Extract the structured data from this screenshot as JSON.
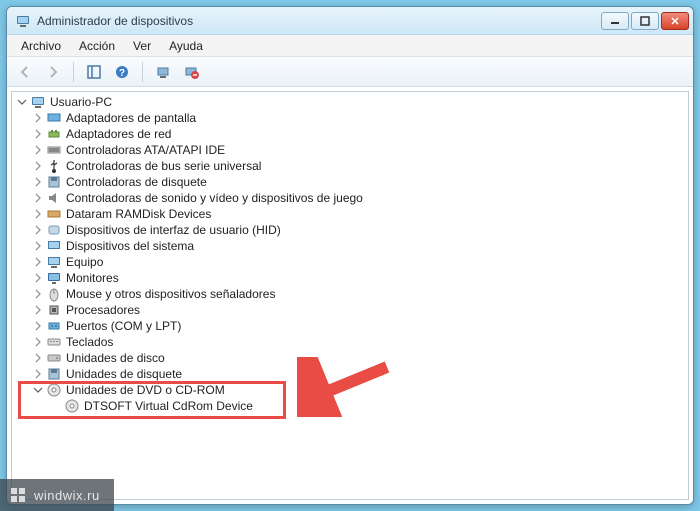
{
  "window": {
    "title": "Administrador de dispositivos"
  },
  "menu": {
    "file": "Archivo",
    "action": "Acción",
    "view": "Ver",
    "help": "Ayuda"
  },
  "tree": {
    "root": "Usuario-PC",
    "items": [
      "Adaptadores de pantalla",
      "Adaptadores de red",
      "Controladoras ATA/ATAPI IDE",
      "Controladoras de bus serie universal",
      "Controladoras de disquete",
      "Controladoras de sonido y vídeo y dispositivos de juego",
      "Dataram RAMDisk Devices",
      "Dispositivos de interfaz de usuario (HID)",
      "Dispositivos del sistema",
      "Equipo",
      "Monitores",
      "Mouse y otros dispositivos señaladores",
      "Procesadores",
      "Puertos (COM y LPT)",
      "Teclados",
      "Unidades de disco",
      "Unidades de disquete"
    ],
    "expanded_item": "Unidades de DVD o CD-ROM",
    "expanded_child": "DTSOFT Virtual CdRom Device"
  },
  "watermark": {
    "text": "windwix.ru"
  }
}
